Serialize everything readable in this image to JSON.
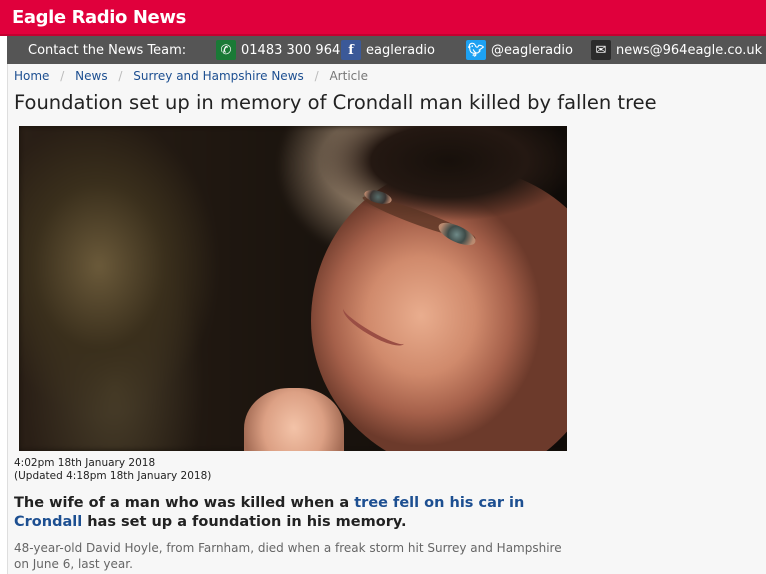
{
  "site": {
    "title": "Eagle Radio News"
  },
  "contact_bar": {
    "label": "Contact the News Team:",
    "phone": "01483 300 964",
    "facebook": "eagleradio",
    "twitter": "@eagleradio",
    "email": "news@964eagle.co.uk",
    "icons": {
      "phone": "phone-icon",
      "facebook": "facebook-icon",
      "twitter": "twitter-icon",
      "email": "envelope-icon"
    }
  },
  "breadcrumb": {
    "items": [
      "Home",
      "News",
      "Surrey and Hampshire News"
    ],
    "current": "Article"
  },
  "article": {
    "headline": "Foundation set up in memory of Crondall man killed by fallen tree",
    "published": "4:02pm 18th January 2018",
    "updated": "(Updated 4:18pm 18th January 2018)",
    "lead_before": "The wife of a man who was killed when a ",
    "lead_link": "tree fell on his car in Crondall",
    "lead_after": " has set up a foundation in his memory.",
    "body": "48-year-old David Hoyle, from Farnham, died when a freak storm hit Surrey and Hampshire on June 6, last year."
  },
  "colors": {
    "brand": "#e0003c",
    "contact_bar": "#555555",
    "link": "#1d4f91"
  }
}
